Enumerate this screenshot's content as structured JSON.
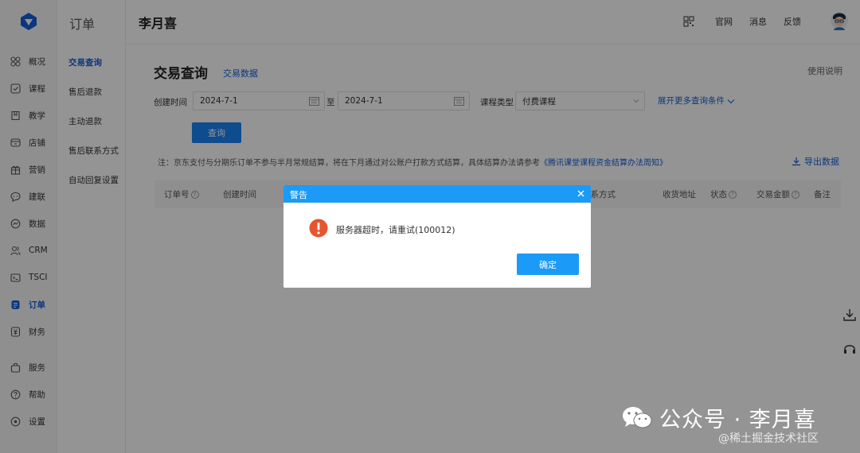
{
  "sidebar": {
    "items": [
      {
        "label": "概况",
        "icon": "overview-icon"
      },
      {
        "label": "课程",
        "icon": "course-icon"
      },
      {
        "label": "教学",
        "icon": "teaching-icon"
      },
      {
        "label": "店铺",
        "icon": "store-icon"
      },
      {
        "label": "营销",
        "icon": "gift-icon"
      },
      {
        "label": "建联",
        "icon": "chat-icon"
      },
      {
        "label": "数据",
        "icon": "data-icon"
      },
      {
        "label": "CRM",
        "icon": "users-icon"
      },
      {
        "label": "TSCI",
        "icon": "terminal-icon"
      },
      {
        "label": "订单",
        "icon": "order-icon",
        "active": true
      },
      {
        "label": "财务",
        "icon": "finance-icon"
      },
      {
        "label": "服务",
        "icon": "bag-icon"
      },
      {
        "label": "帮助",
        "icon": "help-icon"
      },
      {
        "label": "设置",
        "icon": "settings-icon"
      }
    ]
  },
  "subsidebar": {
    "title": "订单",
    "items": [
      "交易查询",
      "售后退款",
      "主动退款",
      "售后联系方式",
      "自动回复设置"
    ]
  },
  "header": {
    "title": "李月喜",
    "links": [
      "官网",
      "消息",
      "反馈"
    ]
  },
  "main": {
    "title": "交易查询",
    "tab": "交易数据",
    "help": "使用说明",
    "filters": {
      "created_label": "创建时间",
      "start_date": "2024-7-1",
      "to": "至",
      "end_date": "2024-7-1",
      "course_type_label": "课程类型",
      "course_type_value": "付费课程",
      "expand": "展开更多查询条件"
    },
    "query_button": "查询",
    "notice": "注：京东支付与分期乐订单不参与半月常规结算，将在下月通过对公账户打款方式结算，具体结算办法请参考",
    "notice_link": "《腾讯课堂课程资金结算办法周知》",
    "export": "导出数据",
    "table_headers": [
      "订单号",
      "创建时间",
      "联系方式",
      "收货地址",
      "状态",
      "交易金额",
      "备注"
    ]
  },
  "modal": {
    "title": "警告",
    "message": "服务器超时，请重试(100012)",
    "ok": "确定"
  },
  "watermark": {
    "text": "公众号 · 李月喜",
    "sub": "@稀土掘金技术社区"
  },
  "colors": {
    "accent": "#1b83f5",
    "modal_header": "#1b9af7",
    "warning": "#e8542e"
  }
}
